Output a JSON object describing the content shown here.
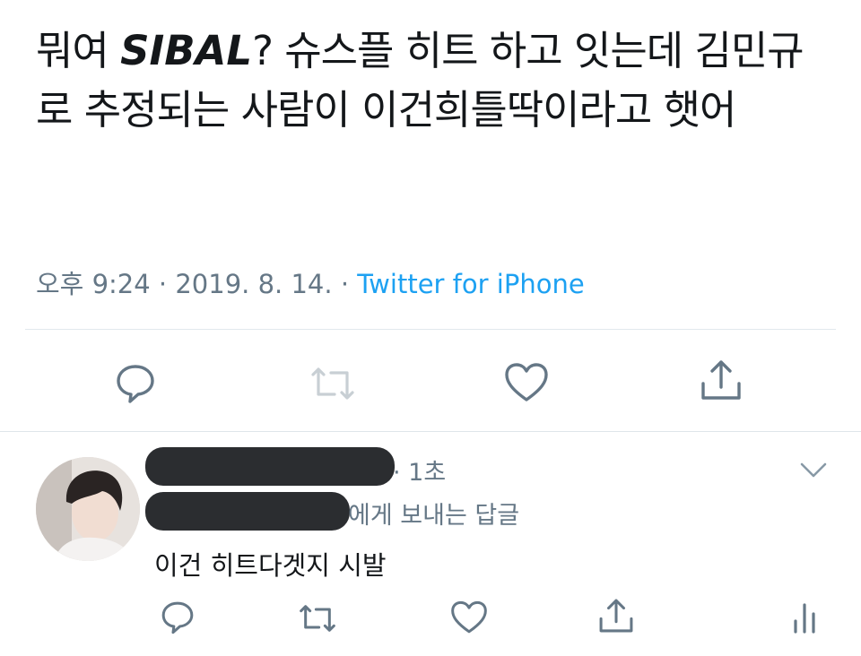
{
  "tweet": {
    "text_part1": "뭐여 ",
    "text_emph": "SIBAL",
    "text_part2": "? 슈스플 히트 하고 잇는데 김민규로 추정되는 사람이 이건희틀딱이라고 햇어",
    "time": "오후 9:24",
    "sep1": " · ",
    "date": "2019. 8. 14.",
    "sep2": " · ",
    "source": "Twitter for iPhone"
  },
  "tweet_actions": {
    "icons": [
      "reply-icon",
      "retweet-icon",
      "like-icon",
      "share-icon"
    ]
  },
  "reply": {
    "time": "· 1초",
    "replying_to": "에게 보내는 답글",
    "text": "이건 히트다겟지 시발"
  },
  "reply_actions": {
    "icons": [
      "reply-icon",
      "retweet-icon",
      "like-icon",
      "share-icon",
      "analytics-icon"
    ]
  },
  "colors": {
    "text": "#14171a",
    "secondary": "#657786",
    "link": "#1da1f2",
    "divider": "#e1e8ed",
    "redaction": "#2b2d30"
  }
}
